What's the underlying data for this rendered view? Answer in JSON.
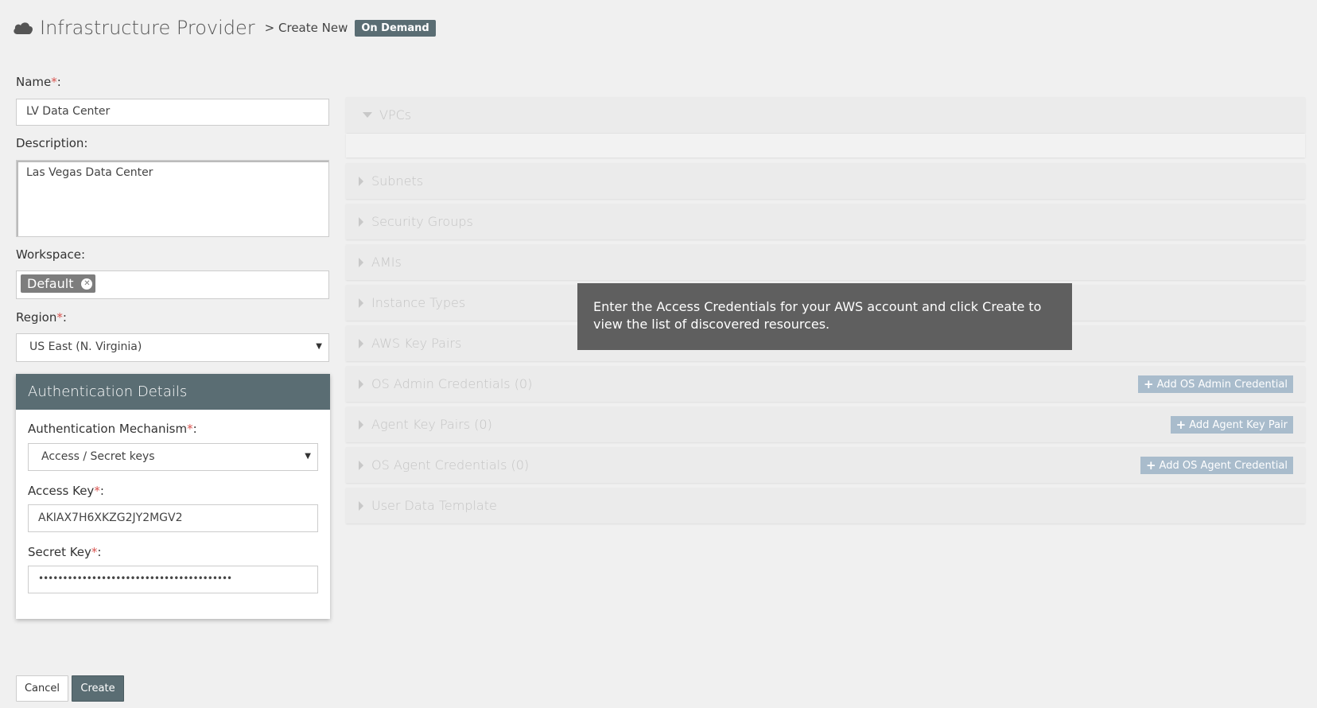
{
  "header": {
    "title": "Infrastructure Provider",
    "breadcrumb": "> Create New",
    "badge": "On Demand"
  },
  "form": {
    "name_label": "Name",
    "name_value": "LV Data Center",
    "description_label": "Description:",
    "description_value": "Las Vegas Data Center",
    "workspace_label": "Workspace:",
    "workspace_tag": "Default",
    "region_label": "Region",
    "region_value": "US East (N. Virginia)",
    "required_mark": "*",
    "colon": ":"
  },
  "auth": {
    "heading": "Authentication Details",
    "mechanism_label": "Authentication Mechanism",
    "mechanism_value": "Access / Secret keys",
    "access_key_label": "Access Key",
    "access_key_value": "AKIAX7H6XKZG2JY2MGV2",
    "secret_key_label": "Secret Key",
    "secret_key_value": "••••••••••••••••••••••••••••••••••••••••"
  },
  "buttons": {
    "cancel": "Cancel",
    "create": "Create"
  },
  "panels": {
    "vpcs": "VPCs",
    "subnets": "Subnets",
    "security_groups": "Security Groups",
    "amis": "AMIs",
    "instance_types": "Instance Types",
    "aws_key_pairs": "AWS Key Pairs",
    "os_admin_credentials": "OS Admin Credentials (0)",
    "agent_key_pairs": "Agent Key Pairs (0)",
    "os_agent_credentials": "OS Agent Credentials (0)",
    "user_data_template": "User Data Template"
  },
  "panel_actions": {
    "add_os_admin": "Add OS Admin Credential",
    "add_agent_key": "Add Agent Key Pair",
    "add_os_agent": "Add OS Agent Credential"
  },
  "tooltip": "Enter the Access Credentials for your AWS account and click Create to view the list of discovered resources.",
  "icons": {
    "cloud": "cloud-icon",
    "remove_tag": "close-circle-icon",
    "select_arrow": "caret-down-icon",
    "plus": "plus-icon"
  },
  "colors": {
    "accent": "#5a6d73",
    "add_button": "#a9bccc",
    "required": "#d9534f",
    "tooltip_bg": "#5f5f5f"
  }
}
